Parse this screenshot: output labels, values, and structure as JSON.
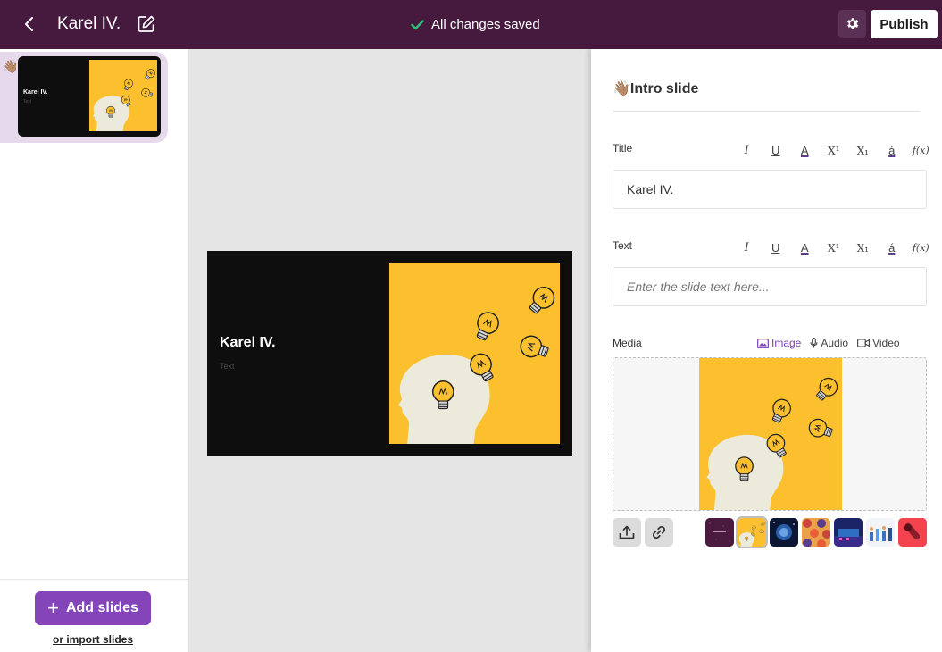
{
  "header": {
    "title": "Karel IV.",
    "save_status": "All changes saved",
    "publish_label": "Publish",
    "icons": [
      "chevron-left-icon",
      "edit-icon",
      "check-icon",
      "gear-icon"
    ]
  },
  "slides": [
    {
      "emoji": "👋🏽",
      "title": "Karel IV.",
      "text": "Text"
    }
  ],
  "left_footer": {
    "add_label": "Add slides",
    "import_label": "or import slides"
  },
  "canvas": {
    "slide_title": "Karel IV.",
    "slide_text": "Text"
  },
  "panel": {
    "heading": "👋🏽Intro slide",
    "title_label": "Title",
    "title_value": "Karel IV.",
    "text_label": "Text",
    "text_placeholder": "Enter the slide text here...",
    "media_label": "Media",
    "media_tabs": [
      "Image",
      "Audio",
      "Video"
    ],
    "active_media_tab": "Image",
    "toolbar": [
      "I",
      "U",
      "A",
      "X¹",
      "X₁",
      "á",
      "f(x)"
    ]
  },
  "colors": {
    "topbar": "#46193f",
    "accent": "#8345b8",
    "slide_bg": "#0e0e0e",
    "image_yellow": "#fcc02e",
    "check": "#2fc47a"
  }
}
